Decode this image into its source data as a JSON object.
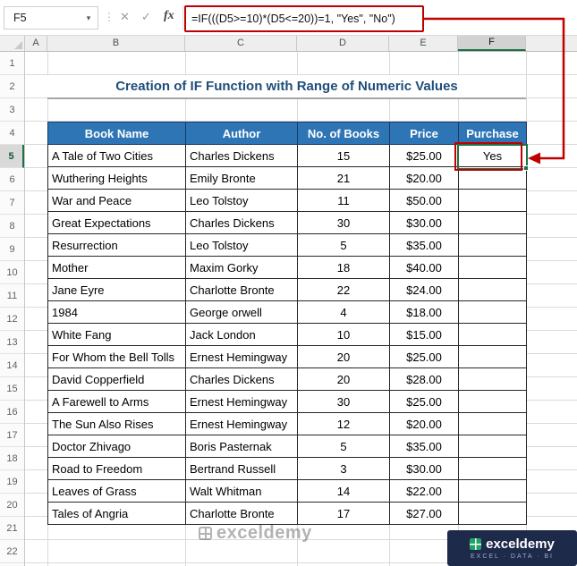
{
  "formula_bar": {
    "name_box_value": "F5",
    "formula": "=IF(((D5>=10)*(D5<=20))=1, \"Yes\", \"No\")"
  },
  "icons": {
    "dropdown": "▾",
    "dots": "⋮",
    "cancel": "✕",
    "enter": "✓",
    "fx": "fx"
  },
  "grid": {
    "column_headers": [
      "A",
      "B",
      "C",
      "D",
      "E",
      "F"
    ],
    "row_count": 22,
    "selected_cell": "F5",
    "selected_column": "F",
    "selected_row": "5"
  },
  "sheet": {
    "title": "Creation of IF Function with Range of Numeric Values"
  },
  "table": {
    "headers": [
      "Book Name",
      "Author",
      "No. of Books",
      "Price",
      "Purchase"
    ],
    "rows": [
      [
        "A Tale of Two Cities",
        "Charles Dickens",
        "15",
        "$25.00",
        "Yes"
      ],
      [
        "Wuthering Heights",
        "Emily Bronte",
        "21",
        "$20.00",
        ""
      ],
      [
        "War and Peace",
        "Leo Tolstoy",
        "11",
        "$50.00",
        ""
      ],
      [
        "Great Expectations",
        "Charles Dickens",
        "30",
        "$30.00",
        ""
      ],
      [
        "Resurrection",
        "Leo Tolstoy",
        "5",
        "$35.00",
        ""
      ],
      [
        "Mother",
        "Maxim Gorky",
        "18",
        "$40.00",
        ""
      ],
      [
        "Jane Eyre",
        "Charlotte Bronte",
        "22",
        "$24.00",
        ""
      ],
      [
        "1984",
        "George orwell",
        "4",
        "$18.00",
        ""
      ],
      [
        "White Fang",
        "Jack London",
        "10",
        "$15.00",
        ""
      ],
      [
        "For Whom the Bell Tolls",
        "Ernest Hemingway",
        "20",
        "$25.00",
        ""
      ],
      [
        "David Copperfield",
        "Charles Dickens",
        "20",
        "$28.00",
        ""
      ],
      [
        "A Farewell to Arms",
        "Ernest Hemingway",
        "30",
        "$25.00",
        ""
      ],
      [
        "The Sun Also Rises",
        "Ernest Hemingway",
        "12",
        "$20.00",
        ""
      ],
      [
        "Doctor Zhivago",
        "Boris Pasternak",
        "5",
        "$35.00",
        ""
      ],
      [
        "Road to Freedom",
        "Bertrand Russell",
        "3",
        "$30.00",
        ""
      ],
      [
        "Leaves of Grass",
        "Walt Whitman",
        "14",
        "$22.00",
        ""
      ],
      [
        "Tales of Angria",
        "Charlotte Bronte",
        "17",
        "$27.00",
        ""
      ]
    ]
  },
  "watermark": {
    "text": "exceldemy"
  },
  "logo": {
    "brand": "exceldemy",
    "tagline": "EXCEL · DATA · BI"
  },
  "colors": {
    "table_header_blue": "#2E75B6",
    "title_blue": "#1F4E79",
    "highlight_red": "#C00000",
    "selection_green": "#1E7145",
    "logo_navy": "#1E2A4A"
  }
}
